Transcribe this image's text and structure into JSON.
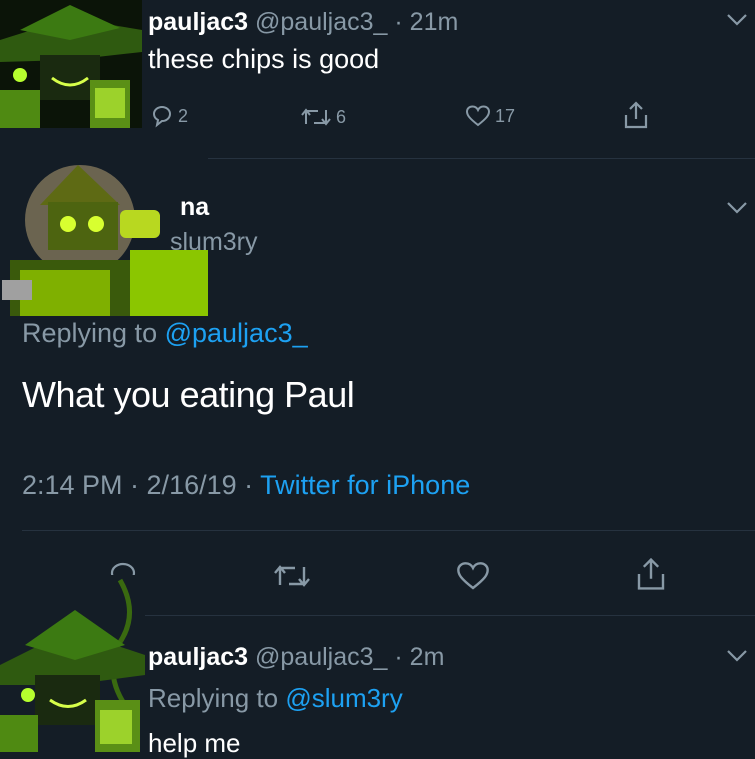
{
  "tweet1": {
    "name": "pauljac3",
    "handle": "@pauljac3_",
    "time": "· 21m",
    "text": "these chips is good",
    "replies": "2",
    "retweets": "6",
    "likes": "17"
  },
  "tweet2": {
    "name": "na",
    "handle": "slum3ry",
    "replying_prefix": "Replying to ",
    "replying_to": "@pauljac3_",
    "text": "What you eating Paul",
    "timestamp": "2:14 PM · 2/16/19 · ",
    "source": "Twitter for iPhone"
  },
  "tweet3": {
    "name": "pauljac3",
    "handle": "@pauljac3_",
    "time": "· 2m",
    "replying_prefix": "Replying to ",
    "replying_to": "@slum3ry",
    "text": "help me"
  },
  "colors": {
    "background": "#141d26",
    "secondary_text": "#8899a6",
    "link": "#1da1f2",
    "avatar_green": "#8bc600"
  }
}
